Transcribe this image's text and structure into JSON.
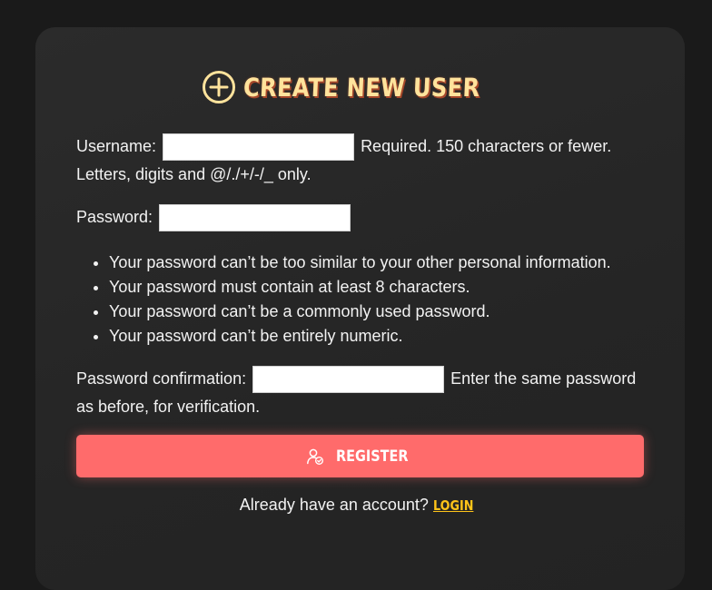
{
  "page": {
    "title": "Create New User",
    "title_icon": "plus-circle-icon",
    "accent_title_color": "#ffe39c",
    "button_color": "#ff6b6b",
    "link_color": "#ffc419"
  },
  "form": {
    "username": {
      "label": "Username:",
      "value": "",
      "help_inline": "Required. 150 characters or fewer.",
      "help_wrap": "Letters, digits and @/./+/-/_ only."
    },
    "password": {
      "label": "Password:",
      "value": "",
      "rules": [
        "Your password can’t be too similar to your other personal information.",
        "Your password must contain at least 8 characters.",
        "Your password can’t be a commonly used password.",
        "Your password can’t be entirely numeric."
      ]
    },
    "password_confirmation": {
      "label": "Password confirmation:",
      "value": "",
      "help_inline": "Enter the same password",
      "help_wrap": "as before, for verification."
    },
    "register_button": {
      "label": "Register",
      "icon": "user-check-icon"
    }
  },
  "footer": {
    "prompt": "Already have an account? ",
    "login_label": "Login"
  }
}
